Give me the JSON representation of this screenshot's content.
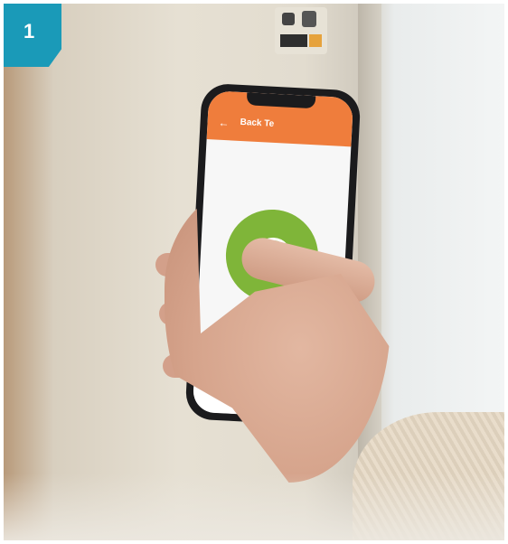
{
  "badge": {
    "number": "1"
  },
  "app": {
    "title": "Back Te",
    "subtitle": "",
    "status": "",
    "nav": [
      {
        "label": "",
        "icon": "home-icon"
      },
      {
        "label": "",
        "icon": "device-icon"
      },
      {
        "label": "",
        "icon": "settings-icon"
      }
    ]
  },
  "colors": {
    "badge": "#1a9ab8",
    "app_header": "#ef7d3c",
    "action_button": "#7fb539"
  }
}
